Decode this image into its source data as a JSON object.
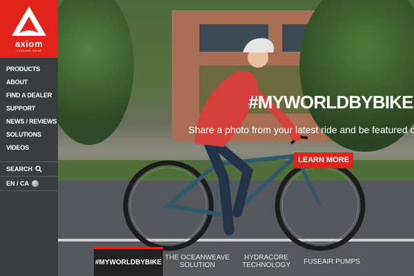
{
  "brand": {
    "name": "axiom",
    "tagline": "CYCLING GEAR",
    "accent_color": "#e2231a"
  },
  "nav": {
    "items": [
      {
        "label": "PRODUCTS"
      },
      {
        "label": "ABOUT"
      },
      {
        "label": "FIND A DEALER"
      },
      {
        "label": "SUPPORT"
      },
      {
        "label": "NEWS / REVIEWS"
      },
      {
        "label": "SOLUTIONS"
      },
      {
        "label": "VIDEOS"
      }
    ],
    "search_label": "SEARCH",
    "search_icon": "search-icon",
    "locale_label": "EN / CA",
    "locale_icon": "globe-icon"
  },
  "hero": {
    "headline": "#MYWORLDBYBIKE",
    "subheadline": "Share a photo from your latest ride and be featured on our",
    "cta_label": "LEARN MORE"
  },
  "tabs": [
    {
      "line1": "#MYWORLDBYBIKE",
      "line2": "",
      "active": true
    },
    {
      "line1": "THE OCEANWEAVE",
      "line2": "SOLUTION",
      "active": false
    },
    {
      "line1": "HYDRACORE",
      "line2": "TECHNOLOGY",
      "active": false
    },
    {
      "line1": "FUSEAIR PUMPS",
      "line2": "",
      "active": false
    }
  ]
}
